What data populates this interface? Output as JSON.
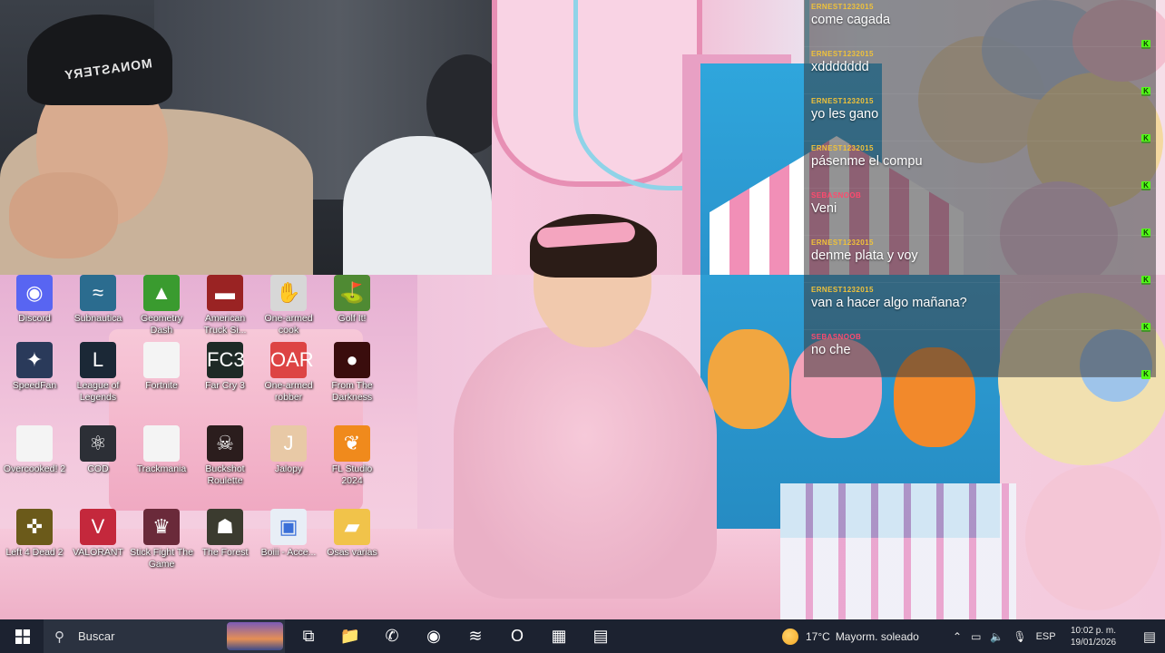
{
  "webcam": {
    "cap_text": "MONASTERY"
  },
  "desktop": {
    "icons": [
      {
        "label": "Discord",
        "icon": "discord-icon",
        "color": "#5865f2",
        "glyph": "◉"
      },
      {
        "label": "Subnautica",
        "icon": "subnautica-icon",
        "color": "#2b6c8f",
        "glyph": "≈"
      },
      {
        "label": "Geometry Dash",
        "icon": "geometry-dash-icon",
        "color": "#3a9b2f",
        "glyph": "▲"
      },
      {
        "label": "American Truck Si...",
        "icon": "american-truck-icon",
        "color": "#9a2323",
        "glyph": "▬"
      },
      {
        "label": "One-armed cook",
        "icon": "one-armed-cook-icon",
        "color": "#d7d7d7",
        "glyph": "✋"
      },
      {
        "label": "Golf It!",
        "icon": "golf-it-icon",
        "color": "#4f8a33",
        "glyph": "⛳"
      },
      {
        "label": "SpeedFan",
        "icon": "speedfan-icon",
        "color": "#2a3a5a",
        "glyph": "✦"
      },
      {
        "label": "League of Legends",
        "icon": "league-of-legends-icon",
        "color": "#1b2836",
        "glyph": "L"
      },
      {
        "label": "Fortnite",
        "icon": "fortnite-file-icon",
        "color": "#f4f4f4",
        "glyph": ""
      },
      {
        "label": "Far Cry 3",
        "icon": "far-cry-3-icon",
        "color": "#1e2a26",
        "glyph": "FC3"
      },
      {
        "label": "One-armed robber",
        "icon": "one-armed-robber-icon",
        "color": "#d44",
        "glyph": "OAR"
      },
      {
        "label": "From The Darkness",
        "icon": "from-the-darkness-icon",
        "color": "#3a0d0d",
        "glyph": "●"
      },
      {
        "label": "Overcooked! 2",
        "icon": "overcooked-file-icon",
        "color": "#f4f4f4",
        "glyph": ""
      },
      {
        "label": "COD",
        "icon": "atom-icon",
        "color": "#2c2f36",
        "glyph": "⚛"
      },
      {
        "label": "Trackmania",
        "icon": "trackmania-file-icon",
        "color": "#f4f4f4",
        "glyph": ""
      },
      {
        "label": "Buckshot Roulette",
        "icon": "buckshot-roulette-icon",
        "color": "#2b1d1d",
        "glyph": "☠"
      },
      {
        "label": "Jalopy",
        "icon": "jalopy-icon",
        "color": "#e8c9a6",
        "glyph": "J"
      },
      {
        "label": "FL Studio 2024",
        "icon": "fl-studio-icon",
        "color": "#f08a1c",
        "glyph": "❦"
      },
      {
        "label": "Left 4 Dead 2",
        "icon": "left-4-dead-2-icon",
        "color": "#6b5a1a",
        "glyph": "✜"
      },
      {
        "label": "VALORANT",
        "icon": "valorant-icon",
        "color": "#c4283c",
        "glyph": "V"
      },
      {
        "label": "Stick Fight The Game",
        "icon": "stick-fight-icon",
        "color": "#6a2a3a",
        "glyph": "♛"
      },
      {
        "label": "The Forest",
        "icon": "the-forest-icon",
        "color": "#3b3b2f",
        "glyph": "☗"
      },
      {
        "label": "Boiii - Acce...",
        "icon": "boiii-shortcut-icon",
        "color": "#e8eef6",
        "glyph": "▣"
      },
      {
        "label": "Osas varias",
        "icon": "folder-icon",
        "color": "#f1c34a",
        "glyph": "▰"
      }
    ]
  },
  "chat": {
    "messages": [
      {
        "user": "ERNEST1232015",
        "user_color": "#f0c23a",
        "text": "come cagada"
      },
      {
        "user": "ERNEST1232015",
        "user_color": "#f0c23a",
        "text": "xddddddd"
      },
      {
        "user": "ERNEST1232015",
        "user_color": "#f0c23a",
        "text": "yo les gano"
      },
      {
        "user": "ERNEST1232015",
        "user_color": "#f0c23a",
        "text": "pásenme el compu"
      },
      {
        "user": "SEBASNOOB",
        "user_color": "#ff4a6e",
        "text": "Veni"
      },
      {
        "user": "ERNEST1232015",
        "user_color": "#f0c23a",
        "text": "denme plata y voy"
      },
      {
        "user": "ERNEST1232015",
        "user_color": "#f0c23a",
        "text": "van a hacer algo mañana?"
      },
      {
        "user": "SEBASNOOB",
        "user_color": "#ff4a6e",
        "text": "no che"
      }
    ],
    "badge_text": "K"
  },
  "taskbar": {
    "search_placeholder": "Buscar",
    "apps": [
      {
        "name": "task-view-icon",
        "glyph": "⧉"
      },
      {
        "name": "file-explorer-icon",
        "glyph": "📁"
      },
      {
        "name": "whatsapp-icon",
        "glyph": "✆"
      },
      {
        "name": "discord-taskbar-icon",
        "glyph": "◉"
      },
      {
        "name": "spotify-icon",
        "glyph": "≋"
      },
      {
        "name": "opera-icon",
        "glyph": "O"
      },
      {
        "name": "kick-app-icon",
        "glyph": "▦"
      },
      {
        "name": "app-icon",
        "glyph": "▤"
      }
    ],
    "weather": {
      "temp": "17°C",
      "desc": "Mayorm. soleado"
    },
    "lang": "ESP",
    "time": "10:02 p. m.",
    "date": "19/01/2026"
  }
}
